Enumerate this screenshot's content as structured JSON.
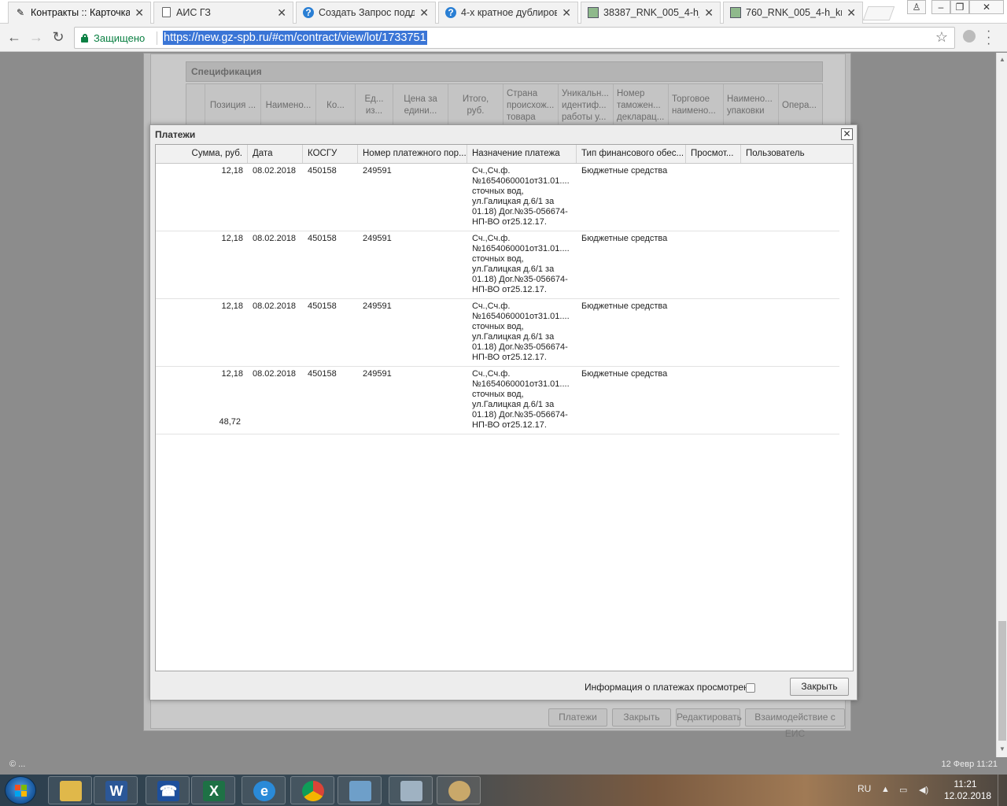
{
  "browser": {
    "tabs": [
      {
        "title": "Контракты :: Карточка",
        "icon": "tools-icon",
        "active": true
      },
      {
        "title": "АИС ГЗ",
        "icon": "document-icon"
      },
      {
        "title": "Создать Запрос подде",
        "icon": "globe-icon"
      },
      {
        "title": "4-х кратное дублиров",
        "icon": "globe-icon"
      },
      {
        "title": "38387_RNK_005_4-h_k",
        "icon": "image-icon"
      },
      {
        "title": "760_RNK_005_4-h_krat",
        "icon": "image-icon"
      }
    ],
    "secure_label": "Защищено",
    "url": "https://new.gz-spb.ru/#cm/contract/view/lot/1733751"
  },
  "background": {
    "spec_title": "Спецификация",
    "spec_columns": [
      "",
      "Позиция ...",
      "Наимено...",
      "Ко...",
      "Ед...\nиз...",
      "Цена за\nедини...",
      "Итого,\nруб.",
      "Страна\nпроисхож...\nтовара",
      "Уникальн...\nидентиф...\nработы у...",
      "Номер\nтаможен...\nдекларац...",
      "Торговое\nнаимено...",
      "Наимено...\nупаковки",
      "Опера..."
    ],
    "buttons": [
      "Платежи",
      "Закрыть",
      "Редактировать",
      "Взаимодействие с ЕИС"
    ]
  },
  "modal": {
    "title": "Платежи",
    "columns": [
      "Сумма, руб.",
      "Дата",
      "КОСГУ",
      "Номер платежного пор...",
      "Назначение платежа",
      "Тип финансового обес...",
      "Просмот...",
      "Пользователь"
    ],
    "rows": [
      {
        "sum": "12,18",
        "date": "08.02.2018",
        "kosgu": "450158",
        "number": "249591",
        "purpose": "Сч.,Сч.ф. №1654060001от31.01.... сточных вод, ул.Галицкая д.6/1 за 01.18) Дог.№35-056674-НП-ВО от25.12.17.",
        "finance_type": "Бюджетные средства",
        "viewed": "",
        "user": ""
      },
      {
        "sum": "12,18",
        "date": "08.02.2018",
        "kosgu": "450158",
        "number": "249591",
        "purpose": "Сч.,Сч.ф. №1654060001от31.01.... сточных вод, ул.Галицкая д.6/1 за 01.18) Дог.№35-056674-НП-ВО от25.12.17.",
        "finance_type": "Бюджетные средства",
        "viewed": "",
        "user": ""
      },
      {
        "sum": "12,18",
        "date": "08.02.2018",
        "kosgu": "450158",
        "number": "249591",
        "purpose": "Сч.,Сч.ф. №1654060001от31.01.... сточных вод, ул.Галицкая д.6/1 за 01.18) Дог.№35-056674-НП-ВО от25.12.17.",
        "finance_type": "Бюджетные средства",
        "viewed": "",
        "user": ""
      },
      {
        "sum": "12,18",
        "date": "08.02.2018",
        "kosgu": "450158",
        "number": "249591",
        "purpose": "Сч.,Сч.ф. №1654060001от31.01.... сточных вод, ул.Галицкая д.6/1 за 01.18) Дог.№35-056674-НП-ВО от25.12.17.",
        "finance_type": "Бюджетные средства",
        "viewed": "",
        "user": ""
      }
    ],
    "total": "48,72",
    "ack_label": "Информация о платежах просмотрена",
    "ack_checked": false,
    "close_label": "Закрыть"
  },
  "status": {
    "left": "© ...",
    "right": "12 Февр 11:21"
  },
  "taskbar": {
    "apps": [
      "explorer-icon",
      "word-icon",
      "phone-icon",
      "excel-icon",
      "ie-icon",
      "chrome-icon",
      "photos-icon",
      "scanner-icon",
      "paint-icon"
    ],
    "lang": "RU",
    "time": "11:21",
    "date": "12.02.2018"
  }
}
